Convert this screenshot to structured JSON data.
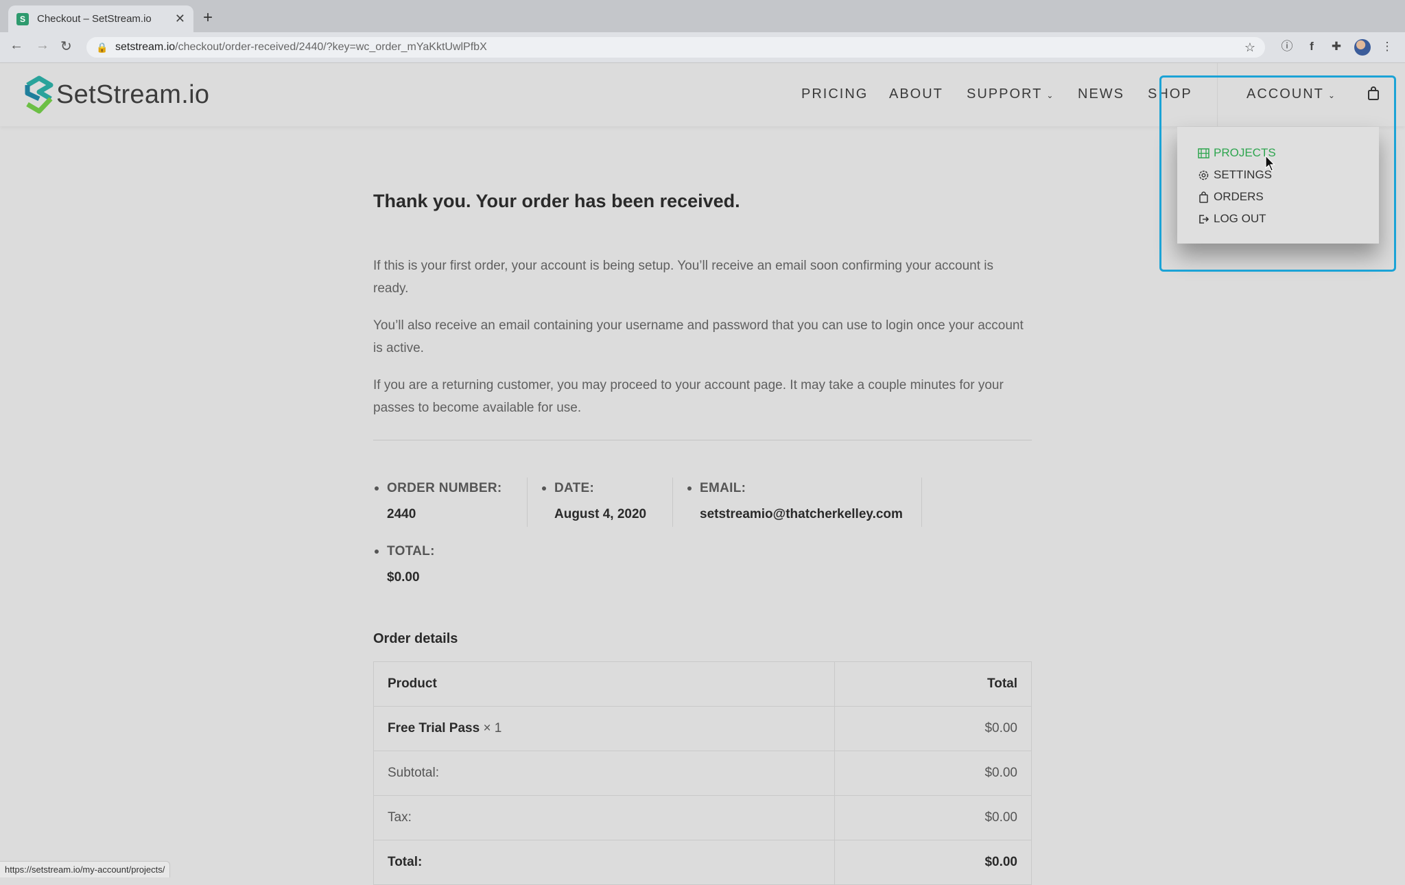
{
  "browser": {
    "tab_title": "Checkout – SetStream.io",
    "url_host": "setstream.io",
    "url_path": "/checkout/order-received/2440/?key=wc_order_mYaKktUwlPfbX",
    "status_url": "https://setstream.io/my-account/projects/"
  },
  "site": {
    "logo_text": "SetStream.io",
    "nav": [
      "PRICING",
      "ABOUT",
      "SUPPORT",
      "NEWS",
      "SHOP",
      "ACCOUNT"
    ],
    "account_menu": [
      "PROJECTS",
      "SETTINGS",
      "ORDERS",
      "LOG OUT"
    ]
  },
  "content": {
    "heading": "Thank you. Your order has been received.",
    "paragraphs": [
      "If this is your first order, your account is being setup. You’ll receive an email soon confirming your account is ready.",
      "You’ll also receive an email containing your username and password that you can use to login once your account is active.",
      "If you are a returning customer, you may proceed to your account page. It may take a couple minutes for your passes to become available for use."
    ],
    "order_meta": {
      "order_number_label": "ORDER NUMBER:",
      "order_number": "2440",
      "date_label": "DATE:",
      "date": "August 4, 2020",
      "email_label": "EMAIL:",
      "email": "setstreamio@thatcherkelley.com",
      "total_label": "TOTAL:",
      "total": "$0.00"
    },
    "order_details_title": "Order details",
    "table": {
      "head": [
        "Product",
        "Total"
      ],
      "item_name": "Free Trial Pass",
      "item_qty": "× 1",
      "item_total": "$0.00",
      "subtotal_label": "Subtotal:",
      "subtotal": "$0.00",
      "tax_label": "Tax:",
      "tax": "$0.00",
      "total_label": "Total:",
      "total": "$0.00"
    }
  },
  "colors": {
    "accent_green": "#2ea54f",
    "highlight_blue": "#1ba3d6"
  }
}
